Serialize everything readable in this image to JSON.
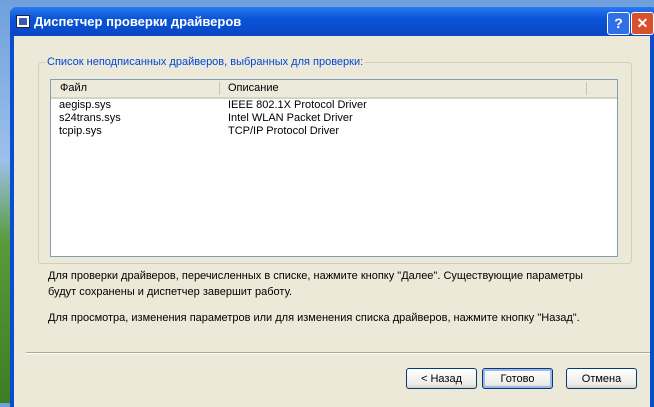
{
  "window": {
    "title": "Диспетчер проверки драйверов",
    "help": "?",
    "close": "✕"
  },
  "group": {
    "caption": "Список неподписанных драйверов, выбранных для проверки:"
  },
  "list": {
    "columns": [
      "Файл",
      "Описание"
    ],
    "rows": [
      {
        "file": "aegisp.sys",
        "desc": "IEEE 802.1X Protocol Driver"
      },
      {
        "file": "s24trans.sys",
        "desc": "Intel WLAN Packet Driver"
      },
      {
        "file": "tcpip.sys",
        "desc": "TCP/IP Protocol Driver"
      }
    ]
  },
  "text": {
    "line1": "Для проверки драйверов, перечисленных в списке, нажмите кнопку \"Далее\". Существующие параметры",
    "line2": "будут сохранены и диспетчер завершит работу.",
    "line3": "Для просмотра, изменения параметров или для изменения списка драйверов, нажмите кнопку \"Назад\"."
  },
  "buttons": {
    "back": "< Назад",
    "finish": "Готово",
    "cancel": "Отмена"
  }
}
